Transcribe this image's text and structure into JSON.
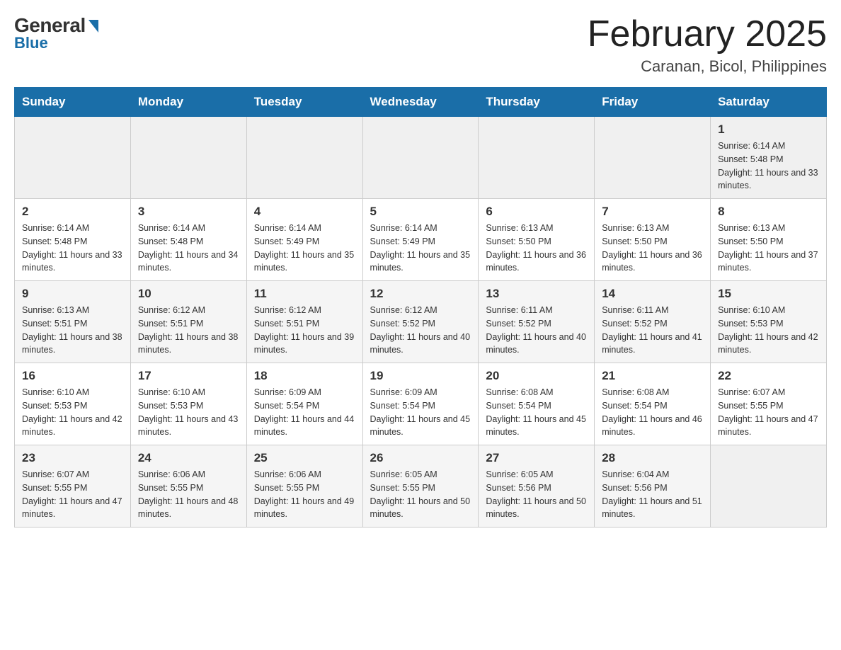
{
  "header": {
    "logo_general": "General",
    "logo_blue": "Blue",
    "month_title": "February 2025",
    "location": "Caranan, Bicol, Philippines"
  },
  "days_of_week": [
    "Sunday",
    "Monday",
    "Tuesday",
    "Wednesday",
    "Thursday",
    "Friday",
    "Saturday"
  ],
  "weeks": [
    {
      "days": [
        {
          "date": "",
          "info": ""
        },
        {
          "date": "",
          "info": ""
        },
        {
          "date": "",
          "info": ""
        },
        {
          "date": "",
          "info": ""
        },
        {
          "date": "",
          "info": ""
        },
        {
          "date": "",
          "info": ""
        },
        {
          "date": "1",
          "info": "Sunrise: 6:14 AM\nSunset: 5:48 PM\nDaylight: 11 hours and 33 minutes."
        }
      ]
    },
    {
      "days": [
        {
          "date": "2",
          "info": "Sunrise: 6:14 AM\nSunset: 5:48 PM\nDaylight: 11 hours and 33 minutes."
        },
        {
          "date": "3",
          "info": "Sunrise: 6:14 AM\nSunset: 5:48 PM\nDaylight: 11 hours and 34 minutes."
        },
        {
          "date": "4",
          "info": "Sunrise: 6:14 AM\nSunset: 5:49 PM\nDaylight: 11 hours and 35 minutes."
        },
        {
          "date": "5",
          "info": "Sunrise: 6:14 AM\nSunset: 5:49 PM\nDaylight: 11 hours and 35 minutes."
        },
        {
          "date": "6",
          "info": "Sunrise: 6:13 AM\nSunset: 5:50 PM\nDaylight: 11 hours and 36 minutes."
        },
        {
          "date": "7",
          "info": "Sunrise: 6:13 AM\nSunset: 5:50 PM\nDaylight: 11 hours and 36 minutes."
        },
        {
          "date": "8",
          "info": "Sunrise: 6:13 AM\nSunset: 5:50 PM\nDaylight: 11 hours and 37 minutes."
        }
      ]
    },
    {
      "days": [
        {
          "date": "9",
          "info": "Sunrise: 6:13 AM\nSunset: 5:51 PM\nDaylight: 11 hours and 38 minutes."
        },
        {
          "date": "10",
          "info": "Sunrise: 6:12 AM\nSunset: 5:51 PM\nDaylight: 11 hours and 38 minutes."
        },
        {
          "date": "11",
          "info": "Sunrise: 6:12 AM\nSunset: 5:51 PM\nDaylight: 11 hours and 39 minutes."
        },
        {
          "date": "12",
          "info": "Sunrise: 6:12 AM\nSunset: 5:52 PM\nDaylight: 11 hours and 40 minutes."
        },
        {
          "date": "13",
          "info": "Sunrise: 6:11 AM\nSunset: 5:52 PM\nDaylight: 11 hours and 40 minutes."
        },
        {
          "date": "14",
          "info": "Sunrise: 6:11 AM\nSunset: 5:52 PM\nDaylight: 11 hours and 41 minutes."
        },
        {
          "date": "15",
          "info": "Sunrise: 6:10 AM\nSunset: 5:53 PM\nDaylight: 11 hours and 42 minutes."
        }
      ]
    },
    {
      "days": [
        {
          "date": "16",
          "info": "Sunrise: 6:10 AM\nSunset: 5:53 PM\nDaylight: 11 hours and 42 minutes."
        },
        {
          "date": "17",
          "info": "Sunrise: 6:10 AM\nSunset: 5:53 PM\nDaylight: 11 hours and 43 minutes."
        },
        {
          "date": "18",
          "info": "Sunrise: 6:09 AM\nSunset: 5:54 PM\nDaylight: 11 hours and 44 minutes."
        },
        {
          "date": "19",
          "info": "Sunrise: 6:09 AM\nSunset: 5:54 PM\nDaylight: 11 hours and 45 minutes."
        },
        {
          "date": "20",
          "info": "Sunrise: 6:08 AM\nSunset: 5:54 PM\nDaylight: 11 hours and 45 minutes."
        },
        {
          "date": "21",
          "info": "Sunrise: 6:08 AM\nSunset: 5:54 PM\nDaylight: 11 hours and 46 minutes."
        },
        {
          "date": "22",
          "info": "Sunrise: 6:07 AM\nSunset: 5:55 PM\nDaylight: 11 hours and 47 minutes."
        }
      ]
    },
    {
      "days": [
        {
          "date": "23",
          "info": "Sunrise: 6:07 AM\nSunset: 5:55 PM\nDaylight: 11 hours and 47 minutes."
        },
        {
          "date": "24",
          "info": "Sunrise: 6:06 AM\nSunset: 5:55 PM\nDaylight: 11 hours and 48 minutes."
        },
        {
          "date": "25",
          "info": "Sunrise: 6:06 AM\nSunset: 5:55 PM\nDaylight: 11 hours and 49 minutes."
        },
        {
          "date": "26",
          "info": "Sunrise: 6:05 AM\nSunset: 5:55 PM\nDaylight: 11 hours and 50 minutes."
        },
        {
          "date": "27",
          "info": "Sunrise: 6:05 AM\nSunset: 5:56 PM\nDaylight: 11 hours and 50 minutes."
        },
        {
          "date": "28",
          "info": "Sunrise: 6:04 AM\nSunset: 5:56 PM\nDaylight: 11 hours and 51 minutes."
        },
        {
          "date": "",
          "info": ""
        }
      ]
    }
  ]
}
